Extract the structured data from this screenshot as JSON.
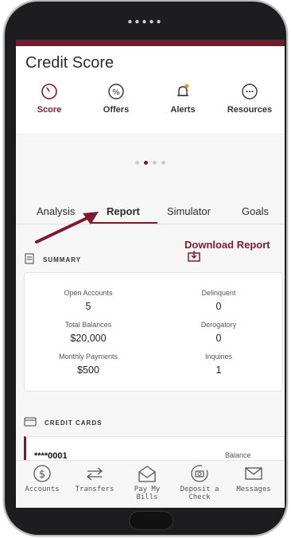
{
  "header": {
    "title": "Credit Score"
  },
  "quick_nav": [
    {
      "label": "Score",
      "icon": "gauge-icon",
      "active": true
    },
    {
      "label": "Offers",
      "icon": "percent-icon"
    },
    {
      "label": "Alerts",
      "icon": "bell-icon"
    },
    {
      "label": "Resources",
      "icon": "more-icon"
    }
  ],
  "pager": {
    "count": 4,
    "active_index": 1
  },
  "tabs": [
    {
      "label": "Analysis"
    },
    {
      "label": "Report",
      "active": true
    },
    {
      "label": "Simulator"
    },
    {
      "label": "Goals"
    }
  ],
  "download_label": "Download Report",
  "summary": {
    "heading": "SUMMARY",
    "items": [
      {
        "label": "Open Accounts",
        "value": "5"
      },
      {
        "label": "Delinquent",
        "value": "0"
      },
      {
        "label": "Total Balances",
        "value": "$20,000"
      },
      {
        "label": "Derogatory",
        "value": "0"
      },
      {
        "label": "Monthly Payments",
        "value": "$500"
      },
      {
        "label": "Inquiries",
        "value": "1"
      }
    ]
  },
  "credit_cards": {
    "heading": "CREDIT CARDS",
    "account": "****0001",
    "balance_label": "Balance"
  },
  "bottom_nav": [
    {
      "line1": "Accounts",
      "line2": "",
      "icon": "dollar-circle-icon"
    },
    {
      "line1": "Transfers",
      "line2": "",
      "icon": "transfer-arrows-icon"
    },
    {
      "line1": "Pay My",
      "line2": "Bills",
      "icon": "bill-envelope-icon"
    },
    {
      "line1": "Deposit a",
      "line2": "Check",
      "icon": "camera-deposit-icon"
    },
    {
      "line1": "Messages",
      "line2": "",
      "icon": "mail-icon"
    }
  ],
  "colors": {
    "brand": "#6b1f2f",
    "accent": "#7a1c2e"
  }
}
